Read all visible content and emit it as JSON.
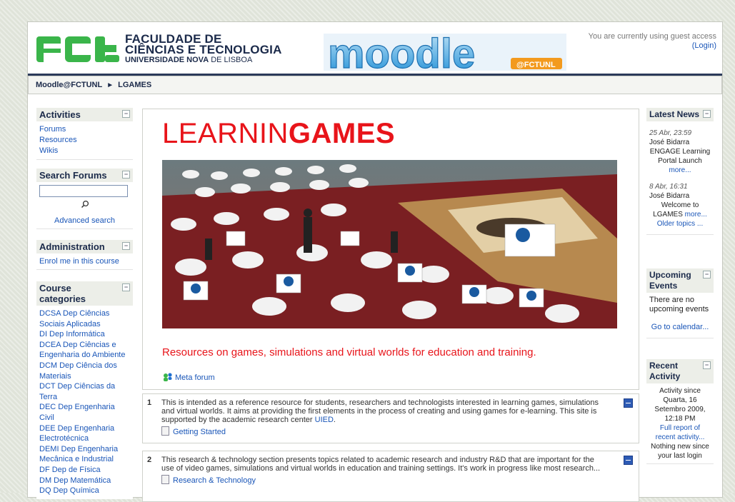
{
  "header": {
    "fct_line1": "FACULDADE DE",
    "fct_line2": "CIÊNCIAS E TECNOLOGIA",
    "fct_line3_bold": "UNIVERSIDADE NOVA",
    "fct_line3_light": " DE LISBOA",
    "moodle_logo_text": "moodle",
    "moodle_logo_sub": "@FCTUNL",
    "guest_text": "You are currently using guest access",
    "login_link": "(Login)"
  },
  "navbar": {
    "home": "Moodle@FCTUNL",
    "separator": "►",
    "current": "LGAMES"
  },
  "left": {
    "activities": {
      "title": "Activities",
      "items": [
        "Forums",
        "Resources",
        "Wikis"
      ]
    },
    "search": {
      "title": "Search Forums",
      "advanced": "Advanced search",
      "placeholder": ""
    },
    "admin": {
      "title": "Administration",
      "enrol": "Enrol me in this course"
    },
    "categories": {
      "title": "Course categories",
      "items": [
        "DCSA Dep Ciências Sociais Aplicadas",
        "DI Dep Informática",
        "DCEA Dep Ciências e Engenharia do Ambiente",
        "DCM Dep Ciência dos Materiais",
        "DCT Dep Ciências da Terra",
        "DEC Dep Engenharia Civil",
        "DEE Dep Engenharia Electrotécnica",
        "DEMI Dep Engenharia Mecânica e Industrial",
        "DF Dep de Física",
        "DM Dep Matemática",
        "DQ Dep Química"
      ]
    }
  },
  "main": {
    "title_light": "LEARNIN",
    "title_bold": "GAMES",
    "tagline": "Resources on games, simulations and virtual worlds for education and training.",
    "meta_forum": "Meta forum",
    "topics": [
      {
        "num": "1",
        "text": "This is intended as a reference resource for students, researchers and technologists interested in learning games, simulations and virtual worlds. It aims at providing the first elements in the process of creating and using games for e-learning. This site is supported by the academic research center ",
        "link": "UIED",
        "tail": ".",
        "resource": "Getting Started"
      },
      {
        "num": "2",
        "text": "This research & technology section presents topics related to academic research and industry R&D that are important for the use of video games, simulations and virtual worlds in education and training settings. It's work in progress like most research...",
        "resource": "Research & Technology"
      }
    ]
  },
  "right": {
    "news": {
      "title": "Latest News",
      "items": [
        {
          "date": "25 Abr, 23:59",
          "author": "José Bidarra",
          "text": "ENGAGE Learning Portal Launch",
          "more": "more..."
        },
        {
          "date": "8 Abr, 16:31",
          "author": "José Bidarra",
          "text": "Welcome to LGAMES",
          "more": "more..."
        }
      ],
      "older": "Older topics ..."
    },
    "events": {
      "title": "Upcoming Events",
      "text": "There are no upcoming events",
      "calendar": "Go to calendar..."
    },
    "activity": {
      "title": "Recent Activity",
      "since": "Activity since Quarta, 16 Setembro 2009, 12:18 PM",
      "full_report": "Full report of recent activity...",
      "nothing": "Nothing new since your last login"
    }
  },
  "colors": {
    "accent_red": "#e8141a",
    "link_blue": "#1a56b8",
    "navy": "#1b2a4a",
    "fct_green": "#3ab54a",
    "moodle_blue": "#1f8fd6",
    "moodle_orange": "#f39a1e"
  }
}
